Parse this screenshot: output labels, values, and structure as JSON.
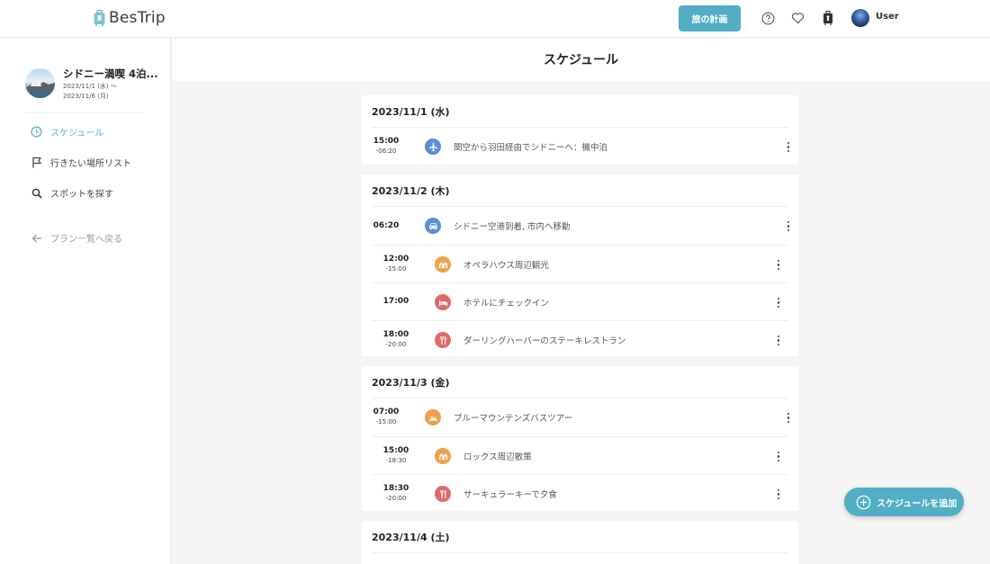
{
  "app": {
    "logo_text": "BesTrip"
  },
  "header": {
    "plan_button": "旅の計画",
    "user_name": "User"
  },
  "sidebar": {
    "trip_title": "シドニー満喫 4泊...",
    "trip_start": "2023/11/1 (水) 〜",
    "trip_end": "2023/11/6 (月)",
    "nav": [
      {
        "label": "スケジュール",
        "icon": "clock-icon",
        "active": true
      },
      {
        "label": "行きたい場所リスト",
        "icon": "flag-icon"
      },
      {
        "label": "スポットを探す",
        "icon": "search-icon"
      }
    ],
    "back_label": "プラン一覧へ戻る"
  },
  "main": {
    "title": "スケジュール"
  },
  "days": [
    {
      "date": "2023/11/1 (水)",
      "items": [
        {
          "start": "15:00",
          "end": "-06:20",
          "title": "関空から羽田経由でシドニーへ：機中泊",
          "category": "flight",
          "color": "#5b8dd9"
        }
      ]
    },
    {
      "date": "2023/11/2 (木)",
      "items": [
        {
          "start": "06:20",
          "end": "",
          "title": "シドニー空港到着, 市内へ移動",
          "category": "car",
          "color": "#5b8dd9"
        },
        {
          "start": "12:00",
          "end": "-15:00",
          "title": "オペラハウス周辺観光",
          "category": "sightseeing",
          "color": "#f0a04b"
        },
        {
          "start": "17:00",
          "end": "",
          "title": "ホテルにチェックイン",
          "category": "hotel",
          "color": "#e0696b"
        },
        {
          "start": "18:00",
          "end": "-20:00",
          "title": "ダーリングハーバーのステーキレストラン",
          "category": "restaurant",
          "color": "#e0696b"
        }
      ]
    },
    {
      "date": "2023/11/3 (金)",
      "items": [
        {
          "start": "07:00",
          "end": "-15:00",
          "title": "ブルーマウンテンズバスツアー",
          "category": "mountain",
          "color": "#f0a04b"
        },
        {
          "start": "15:00",
          "end": "-18:30",
          "title": "ロックス周辺散策",
          "category": "sightseeing",
          "color": "#f0a04b"
        },
        {
          "start": "18:30",
          "end": "-20:00",
          "title": "サーキュラーキーで夕食",
          "category": "restaurant",
          "color": "#e0696b"
        }
      ]
    },
    {
      "date": "2023/11/4 (土)",
      "items": []
    }
  ],
  "fab": {
    "label": "スケジュールを追加"
  },
  "colors": {
    "accent": "#52aec4",
    "flight": "#5b8dd9",
    "sightseeing": "#f0a04b",
    "restaurant": "#e0696b"
  }
}
